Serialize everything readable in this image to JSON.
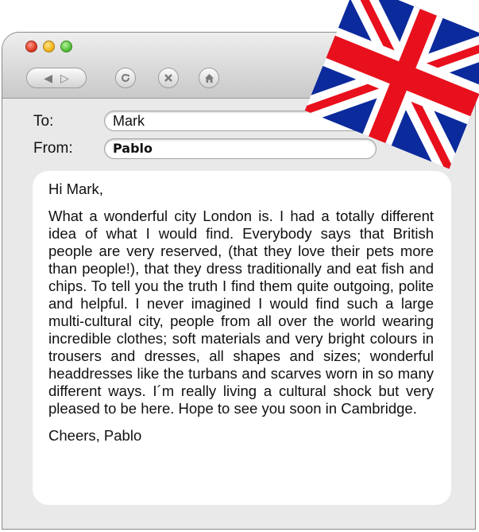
{
  "window": {
    "nav": {
      "back_label": "◀",
      "forward_label": "▷"
    }
  },
  "header": {
    "to_label": "To:",
    "to_value": "Mark",
    "from_label": "From:",
    "from_value": "Pablo"
  },
  "message": {
    "greeting": "Hi Mark,",
    "body": "What a wonderful city London is. I had a totally different idea of what I would find. Everybody says that British people are very reserved, (that they love their pets more than people!), that they dress traditionally and eat fish and chips. To tell you the truth I find them quite outgoing, polite and helpful. I never imagined I would find such a large multi-cultural city, people from all over the world wearing incredible clothes; soft materials and very bright colours in trousers and dresses, all shapes and sizes; wonderful headdresses like the turbans and scarves worn in so many different ways. I´m really living a cultural shock but very pleased to be here. Hope to see you soon in Cambridge.",
    "closing": "Cheers, Pablo"
  },
  "decoration": {
    "flag_icon": "union-jack-flag-icon",
    "colors": {
      "blue": "#0b2a9c",
      "red": "#e8101c",
      "white": "#ffffff"
    }
  }
}
